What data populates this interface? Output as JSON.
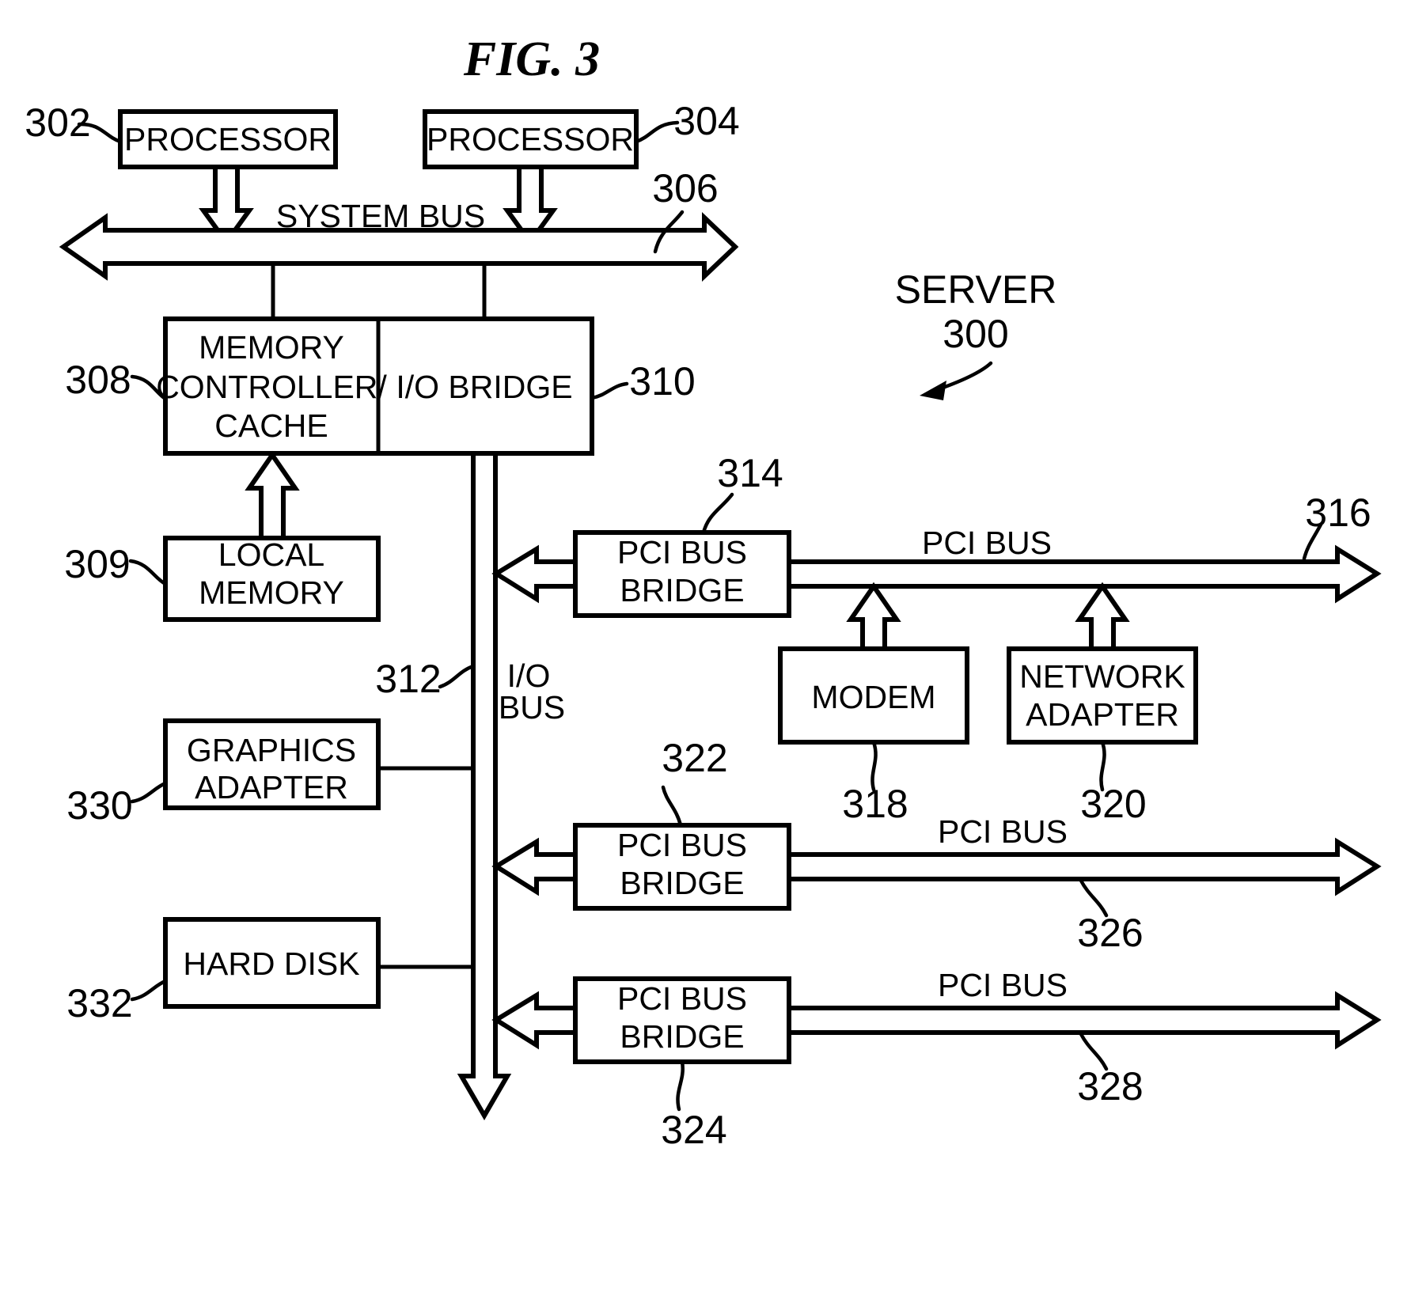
{
  "figure": {
    "title": "FIG. 3",
    "system_label": "SERVER",
    "system_ref": "300"
  },
  "blocks": [
    {
      "id": "processor-1",
      "label_line1": "PROCESSOR",
      "ref": "302"
    },
    {
      "id": "processor-2",
      "label_line1": "PROCESSOR",
      "ref": "304"
    },
    {
      "id": "memory-controller-cache",
      "label_line1": "MEMORY",
      "label_line2": "CONTROLLER/",
      "label_line3": "CACHE",
      "ref": "308"
    },
    {
      "id": "io-bridge",
      "label_line1": "I/O BRIDGE",
      "ref": "310"
    },
    {
      "id": "local-memory",
      "label_line1": "LOCAL",
      "label_line2": "MEMORY",
      "ref": "309"
    },
    {
      "id": "pci-bus-bridge-1",
      "label_line1": "PCI BUS",
      "label_line2": "BRIDGE",
      "ref": "314"
    },
    {
      "id": "modem",
      "label_line1": "MODEM",
      "ref": "318"
    },
    {
      "id": "network-adapter",
      "label_line1": "NETWORK",
      "label_line2": "ADAPTER",
      "ref": "320"
    },
    {
      "id": "graphics-adapter",
      "label_line1": "GRAPHICS",
      "label_line2": "ADAPTER",
      "ref": "330"
    },
    {
      "id": "hard-disk",
      "label_line1": "HARD DISK",
      "ref": "332"
    },
    {
      "id": "pci-bus-bridge-2",
      "label_line1": "PCI BUS",
      "label_line2": "BRIDGE",
      "ref": "322"
    },
    {
      "id": "pci-bus-bridge-3",
      "label_line1": "PCI BUS",
      "label_line2": "BRIDGE",
      "ref": "324"
    }
  ],
  "buses": [
    {
      "id": "system-bus",
      "label": "SYSTEM BUS",
      "ref": "306"
    },
    {
      "id": "io-bus",
      "label_line1": "I/O",
      "label_line2": "BUS",
      "ref": "312"
    },
    {
      "id": "pci-bus-1",
      "label": "PCI BUS",
      "ref": "316"
    },
    {
      "id": "pci-bus-2",
      "label": "PCI BUS",
      "ref": "326"
    },
    {
      "id": "pci-bus-3",
      "label": "PCI BUS",
      "ref": "328"
    }
  ],
  "colors": {
    "stroke": "#000000",
    "fill": "#ffffff"
  }
}
